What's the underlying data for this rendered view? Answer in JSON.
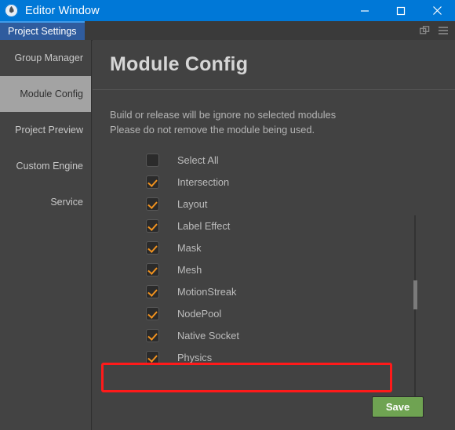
{
  "window": {
    "title": "Editor Window",
    "icon": "cocos-logo-icon",
    "controls": [
      {
        "name": "minimize",
        "glyph": "minimize-icon"
      },
      {
        "name": "maximize",
        "glyph": "maximize-icon"
      },
      {
        "name": "close",
        "glyph": "close-icon"
      }
    ]
  },
  "tabstrip": {
    "tabs": [
      {
        "label": "Project Settings",
        "active": true
      }
    ],
    "tools": [
      {
        "name": "duplicate-panel-icon"
      },
      {
        "name": "panel-menu-icon"
      }
    ]
  },
  "sidebar": {
    "items": [
      {
        "label": "Group Manager",
        "active": false
      },
      {
        "label": "Module Config",
        "active": true
      },
      {
        "label": "Project Preview",
        "active": false
      },
      {
        "label": "Custom Engine",
        "active": false
      },
      {
        "label": "Service",
        "active": false
      }
    ]
  },
  "main": {
    "title": "Module Config",
    "description": [
      "Build or release will be ignore no selected modules",
      "Please do not remove the module being used."
    ],
    "modules": [
      {
        "label": "Select All",
        "checked": false
      },
      {
        "label": "Intersection",
        "checked": true
      },
      {
        "label": "Layout",
        "checked": true
      },
      {
        "label": "Label Effect",
        "checked": true
      },
      {
        "label": "Mask",
        "checked": true
      },
      {
        "label": "Mesh",
        "checked": true
      },
      {
        "label": "MotionStreak",
        "checked": true
      },
      {
        "label": "NodePool",
        "checked": true
      },
      {
        "label": "Native Socket",
        "checked": true
      },
      {
        "label": "Physics",
        "checked": true
      }
    ],
    "highlighted_module": "Native Socket",
    "save_label": "Save"
  },
  "colors": {
    "titlebar": "#0078d7",
    "accent_tab": "#2f5c9e",
    "checkbox_check": "#f0921f",
    "save_button": "#6fa352",
    "highlight_box": "#ff1a1a",
    "sidebar_active": "#a3a3a3"
  }
}
